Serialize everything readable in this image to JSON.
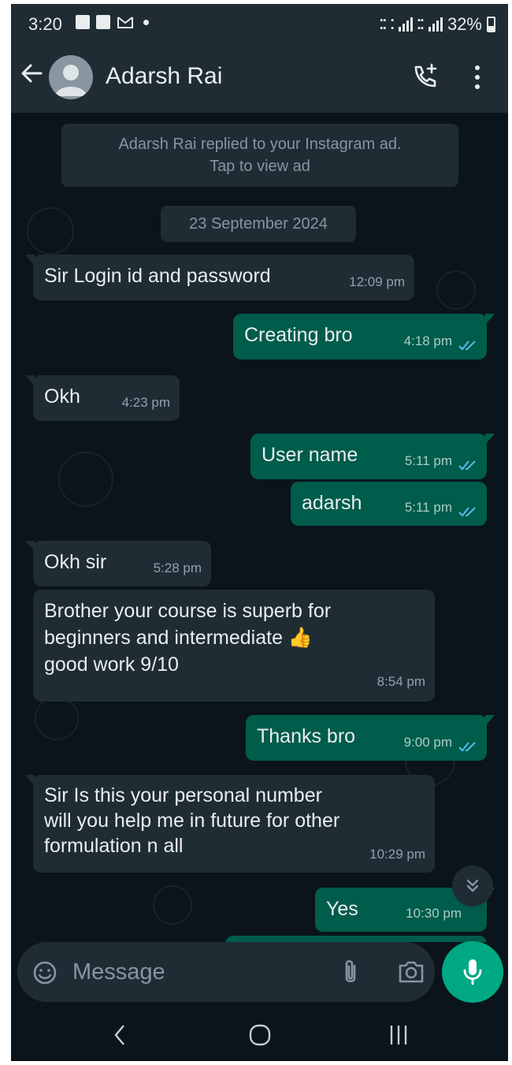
{
  "status_bar": {
    "time": "3:20",
    "battery": "32%",
    "battery_level": 0.32
  },
  "header": {
    "contact_name": "Adarsh Rai",
    "icons": [
      "back-arrow-icon",
      "avatar",
      "add-call-icon",
      "more-vert-icon"
    ]
  },
  "chat": {
    "notice_line1": "Adarsh Rai replied to your Instagram ad.",
    "notice_line2": "Tap to view ad",
    "date": "23 September 2024",
    "messages": [
      {
        "dir": "in",
        "text": "Sir Login id and password",
        "time": "12:09 pm"
      },
      {
        "dir": "out",
        "text": "Creating bro",
        "time": "4:18 pm",
        "read": true
      },
      {
        "dir": "in",
        "text": "Okh",
        "time": "4:23 pm"
      },
      {
        "dir": "out",
        "text": "User name",
        "time": "5:11 pm",
        "read": true
      },
      {
        "dir": "out",
        "text": "adarsh",
        "time": "5:11 pm",
        "read": true
      },
      {
        "dir": "in",
        "text": "Okh sir",
        "time": "5:28 pm"
      },
      {
        "dir": "in",
        "text_lines": [
          "Brother your course is superb for",
          "beginners and intermediate 👍",
          "good work 9/10"
        ],
        "time": "8:54 pm"
      },
      {
        "dir": "out",
        "text": "Thanks bro",
        "time": "9:00 pm",
        "read": true
      },
      {
        "dir": "in",
        "text_lines": [
          "Sir Is this your personal number",
          "will you help me in future for other",
          "formulation n all"
        ],
        "time": "10:29 pm"
      },
      {
        "dir": "out",
        "text": "Yes",
        "time": "10:30 pm",
        "read": true
      }
    ]
  },
  "compose": {
    "placeholder": "Message"
  },
  "colors": {
    "background": "#0b141a",
    "bar": "#1f2c34",
    "incoming": "#1f2c34",
    "outgoing": "#005c4b",
    "accent": "#00a884",
    "read_tick": "#53bdeb"
  }
}
